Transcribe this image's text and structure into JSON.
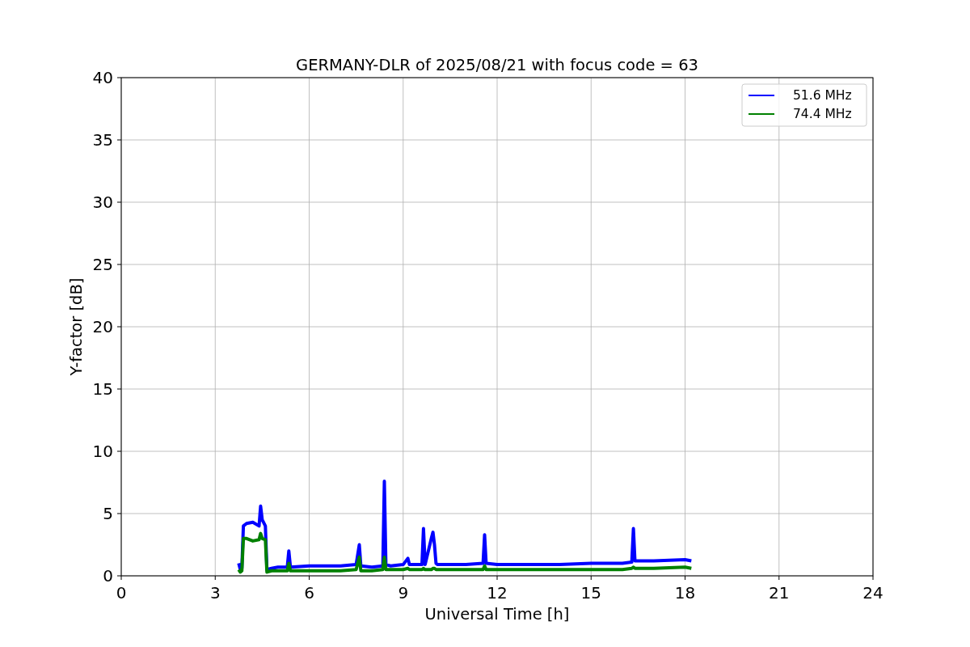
{
  "chart_data": {
    "type": "line",
    "title": "GERMANY-DLR of 2025/08/21 with focus code = 63",
    "xlabel": "Universal Time [h]",
    "ylabel": "Y-factor [dB]",
    "xlim": [
      0,
      24
    ],
    "ylim": [
      0,
      40
    ],
    "xticks": [
      0,
      3,
      6,
      9,
      12,
      15,
      18,
      21,
      24
    ],
    "yticks": [
      0,
      5,
      10,
      15,
      20,
      25,
      30,
      35,
      40
    ],
    "grid": true,
    "legend": true,
    "x": [
      3.75,
      3.8,
      3.85,
      3.9,
      4.0,
      4.2,
      4.4,
      4.45,
      4.5,
      4.6,
      4.65,
      4.8,
      5.0,
      5.3,
      5.35,
      5.4,
      6.0,
      7.0,
      7.5,
      7.6,
      7.65,
      8.0,
      8.35,
      8.4,
      8.45,
      8.6,
      9.0,
      9.15,
      9.2,
      9.6,
      9.65,
      9.7,
      9.9,
      9.95,
      10.0,
      10.05,
      10.1,
      10.5,
      11.0,
      11.55,
      11.6,
      11.65,
      12.0,
      13.0,
      14.0,
      15.0,
      16.0,
      16.3,
      16.35,
      16.4,
      17.0,
      18.0,
      18.2
    ],
    "series": [
      {
        "name": "51.6 MHz",
        "color": "#0000ff",
        "values": [
          1.0,
          0.5,
          0.6,
          4.0,
          4.2,
          4.3,
          4.0,
          5.6,
          4.5,
          4.0,
          0.5,
          0.6,
          0.7,
          0.7,
          2.0,
          0.7,
          0.8,
          0.8,
          0.9,
          2.5,
          0.8,
          0.7,
          0.8,
          7.6,
          0.9,
          0.8,
          0.9,
          1.4,
          0.9,
          0.9,
          3.8,
          0.9,
          3.0,
          3.5,
          2.5,
          1.0,
          0.9,
          0.9,
          0.9,
          1.0,
          3.3,
          1.0,
          0.9,
          0.9,
          0.9,
          1.0,
          1.0,
          1.1,
          3.8,
          1.2,
          1.2,
          1.3,
          1.2
        ]
      },
      {
        "name": "74.4 MHz",
        "color": "#008000",
        "values": [
          0.5,
          0.3,
          0.4,
          3.0,
          3.0,
          2.8,
          2.9,
          3.4,
          3.0,
          2.9,
          0.3,
          0.4,
          0.4,
          0.4,
          1.0,
          0.4,
          0.4,
          0.4,
          0.5,
          1.5,
          0.4,
          0.4,
          0.5,
          1.5,
          0.5,
          0.5,
          0.5,
          0.6,
          0.5,
          0.5,
          0.6,
          0.5,
          0.5,
          0.6,
          0.6,
          0.5,
          0.5,
          0.5,
          0.5,
          0.5,
          0.8,
          0.5,
          0.5,
          0.5,
          0.5,
          0.5,
          0.5,
          0.6,
          0.7,
          0.6,
          0.6,
          0.7,
          0.6
        ]
      }
    ]
  }
}
